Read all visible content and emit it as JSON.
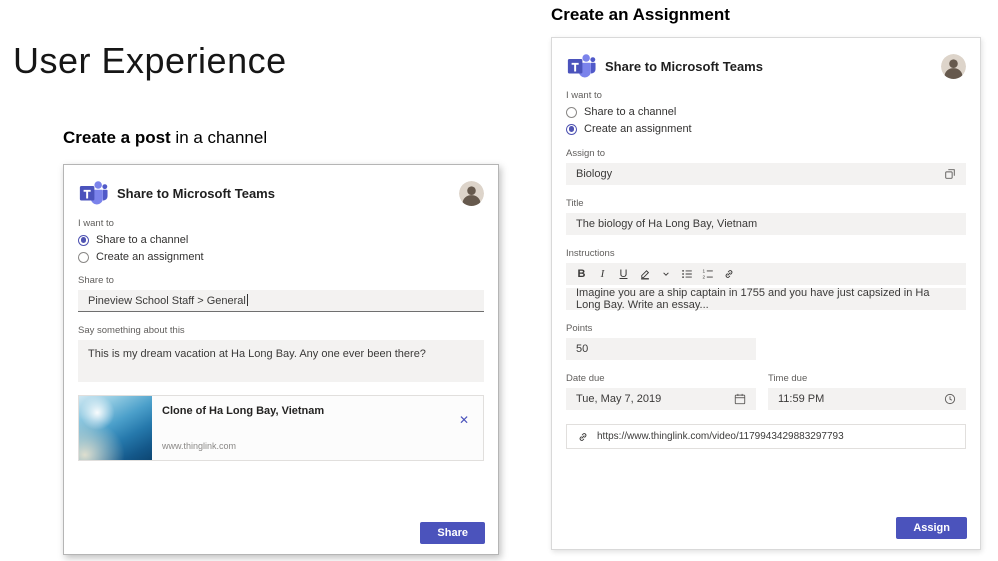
{
  "slide": {
    "main_title": "User Experience",
    "left_caption_bold": "Create a post",
    "left_caption_rest": " in a channel",
    "right_caption": "Create an Assignment"
  },
  "colors": {
    "brand": "#4b53bc",
    "radio_selected": "#4f53b2",
    "input_bg": "#f3f2f1"
  },
  "post_dialog": {
    "title": "Share to Microsoft Teams",
    "i_want_to": "I want to",
    "radio_channel": "Share to a channel",
    "radio_assignment": "Create an assignment",
    "share_to_label": "Share to",
    "share_to_value": "Pineview School Staff > General",
    "say_label": "Say something about this",
    "say_value": "This is my dream vacation at Ha Long Bay. Any one ever been there?",
    "card": {
      "title": "Clone of Ha Long Bay, Vietnam",
      "domain": "www.thinglink.com",
      "close_icon": "✕"
    },
    "share_button": "Share"
  },
  "assignment_dialog": {
    "title": "Share to Microsoft Teams",
    "i_want_to": "I want to",
    "radio_channel": "Share to a channel",
    "radio_assignment": "Create an assignment",
    "assign_to_label": "Assign to",
    "assign_to_value": "Biology",
    "title_label": "Title",
    "title_value": "The biology of Ha Long Bay, Vietnam",
    "instructions_label": "Instructions",
    "instructions_value": "Imagine you are a ship captain in 1755 and you have just capsized in Ha Long Bay. Write an essay...",
    "toolbar": {
      "bold": "B",
      "italic": "I",
      "underline": "U"
    },
    "points_label": "Points",
    "points_value": "50",
    "date_label": "Date due",
    "date_value": "Tue, May 7, 2019",
    "time_label": "Time due",
    "time_value": "11:59 PM",
    "link_value": "https://www.thinglink.com/video/1179943429883297793",
    "assign_button": "Assign"
  }
}
